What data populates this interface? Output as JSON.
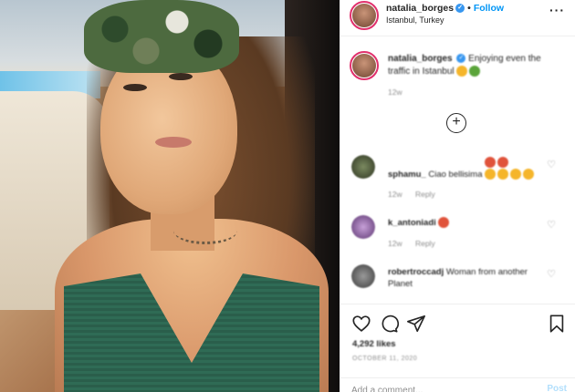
{
  "header": {
    "username": "natalia_borges",
    "follow_label": "Follow",
    "location": "Istanbul, Turkey",
    "more_icon": "more-horizontal-icon"
  },
  "caption": {
    "username": "natalia_borges",
    "text": "Enjoying even the traffic in Istanbul",
    "time": "12w"
  },
  "comments": [
    {
      "username": "sphamu_",
      "text": "Ciao bellisima",
      "time": "12w",
      "reply": "Reply"
    },
    {
      "username": "k_antoniadi",
      "text": "",
      "time": "12w",
      "reply": "Reply"
    },
    {
      "username": "robertroccadj",
      "text": "Woman from another Planet",
      "time": "",
      "reply": ""
    }
  ],
  "actions": {
    "likes": "4,292 likes",
    "date": "OCTOBER 11, 2020"
  },
  "add_comment": {
    "placeholder": "Add a comment...",
    "post_label": "Post"
  },
  "colors": {
    "follow": "#0095f6",
    "verified": "#3897f0",
    "story_ring": "#e1306c",
    "post_disabled": "#b2dffc"
  }
}
